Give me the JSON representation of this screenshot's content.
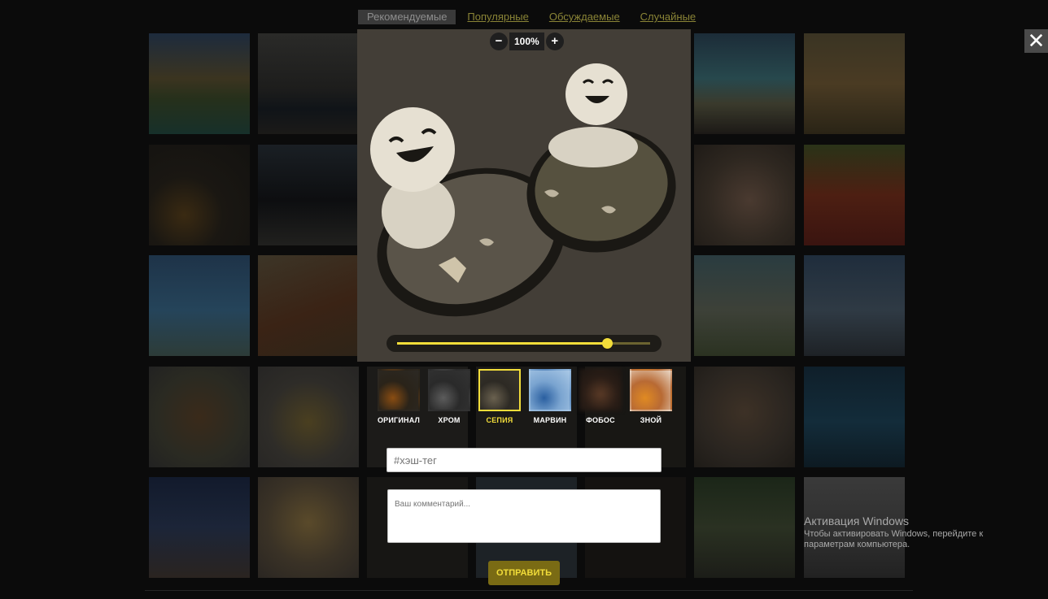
{
  "nav_tabs": [
    {
      "label": "Рекомендуемые",
      "active": true
    },
    {
      "label": "Популярные",
      "active": false
    },
    {
      "label": "Обсуждаемые",
      "active": false
    },
    {
      "label": "Случайные",
      "active": false
    }
  ],
  "viewer": {
    "zoom_minus": "−",
    "zoom_value": "100%",
    "zoom_plus": "+",
    "intensity": 0.83,
    "close_glyph": "✕"
  },
  "filters": [
    {
      "label": "ОРИГИНАЛ",
      "selected": false
    },
    {
      "label": "ХРОМ",
      "selected": false
    },
    {
      "label": "СЕПИЯ",
      "selected": true
    },
    {
      "label": "МАРВИН",
      "selected": false
    },
    {
      "label": "ФОБОС",
      "selected": false
    },
    {
      "label": "ЗНОЙ",
      "selected": false
    }
  ],
  "form": {
    "hashtag_placeholder": "#хэш-тег",
    "comment_placeholder": "Ваш комментарий...",
    "submit_label": "ОТПРАВИТЬ"
  },
  "watermark": {
    "title": "Активация Windows",
    "text": "Чтобы активировать Windows, перейдите к параметрам компьютера."
  },
  "colors": {
    "accent": "#f2dd3a",
    "background": "#0b0b0b",
    "tab_link": "#8a8436"
  }
}
